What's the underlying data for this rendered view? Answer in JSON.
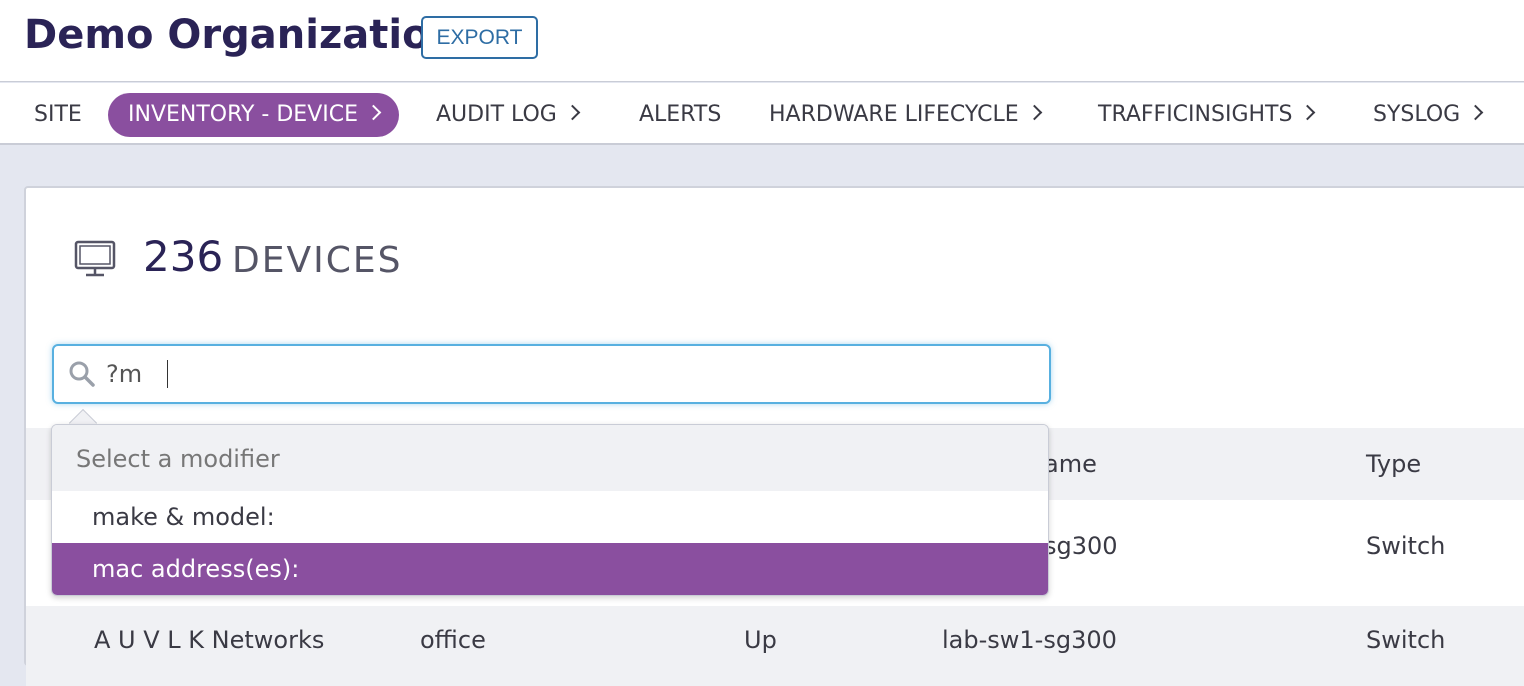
{
  "header": {
    "title": "Demo Organization",
    "export_label": "EXPORT"
  },
  "nav": {
    "items": [
      {
        "label": "SITE"
      },
      {
        "label": "INVENTORY - DEVICE"
      },
      {
        "label": "AUDIT LOG"
      },
      {
        "label": "ALERTS"
      },
      {
        "label": "HARDWARE LIFECYCLE"
      },
      {
        "label": "TRAFFICINSIGHTS"
      },
      {
        "label": "SYSLOG"
      }
    ],
    "active_color": "#8a4f9f"
  },
  "main": {
    "count": "236",
    "count_label": "DEVICES",
    "icon": "monitor-icon",
    "search": {
      "value": "?m",
      "icon": "search-icon"
    },
    "table": {
      "columns": [
        {
          "label": "ame"
        },
        {
          "label": "Type"
        }
      ],
      "rows": [
        {
          "name": "sg300",
          "type": "Switch"
        },
        {
          "make": "A U V L K Networks",
          "site": "office",
          "status": "Up",
          "name": "lab-sw1-sg300",
          "type": "Switch"
        }
      ]
    }
  },
  "dropdown": {
    "header": "Select a modifier",
    "items": [
      {
        "label": "make & model:"
      },
      {
        "label": "mac address(es):"
      }
    ],
    "selected_color": "#8a4f9f"
  }
}
